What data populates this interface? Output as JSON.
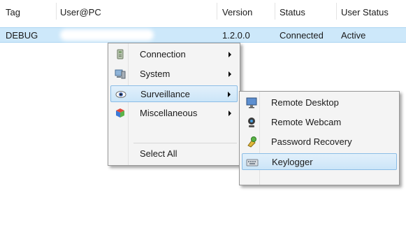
{
  "table": {
    "headers": [
      "Tag",
      "User@PC",
      "Version",
      "Status",
      "User Status"
    ],
    "row": {
      "tag": "DEBUG",
      "user_pc": "",
      "version": "1.2.0.0",
      "status": "Connected",
      "user_status": "Active"
    }
  },
  "context_menu": {
    "items": [
      {
        "label": "Connection",
        "icon": "connection-icon",
        "submenu": true
      },
      {
        "label": "System",
        "icon": "system-icon",
        "submenu": true
      },
      {
        "label": "Surveillance",
        "icon": "eye-icon",
        "submenu": true,
        "selected": true
      },
      {
        "label": "Miscellaneous",
        "icon": "misc-icon",
        "submenu": true
      },
      {
        "label": "Select All",
        "icon": "",
        "submenu": false
      }
    ]
  },
  "surveillance_menu": {
    "items": [
      {
        "label": "Remote Desktop",
        "icon": "monitor-icon"
      },
      {
        "label": "Remote Webcam",
        "icon": "webcam-icon"
      },
      {
        "label": "Password Recovery",
        "icon": "key-icon"
      },
      {
        "label": "Keylogger",
        "icon": "keyboard-icon",
        "selected": true
      }
    ]
  },
  "colors": {
    "selection": "#cde8fa",
    "menu_bg": "#f4f4f4",
    "highlight_border": "#8bbde6"
  }
}
